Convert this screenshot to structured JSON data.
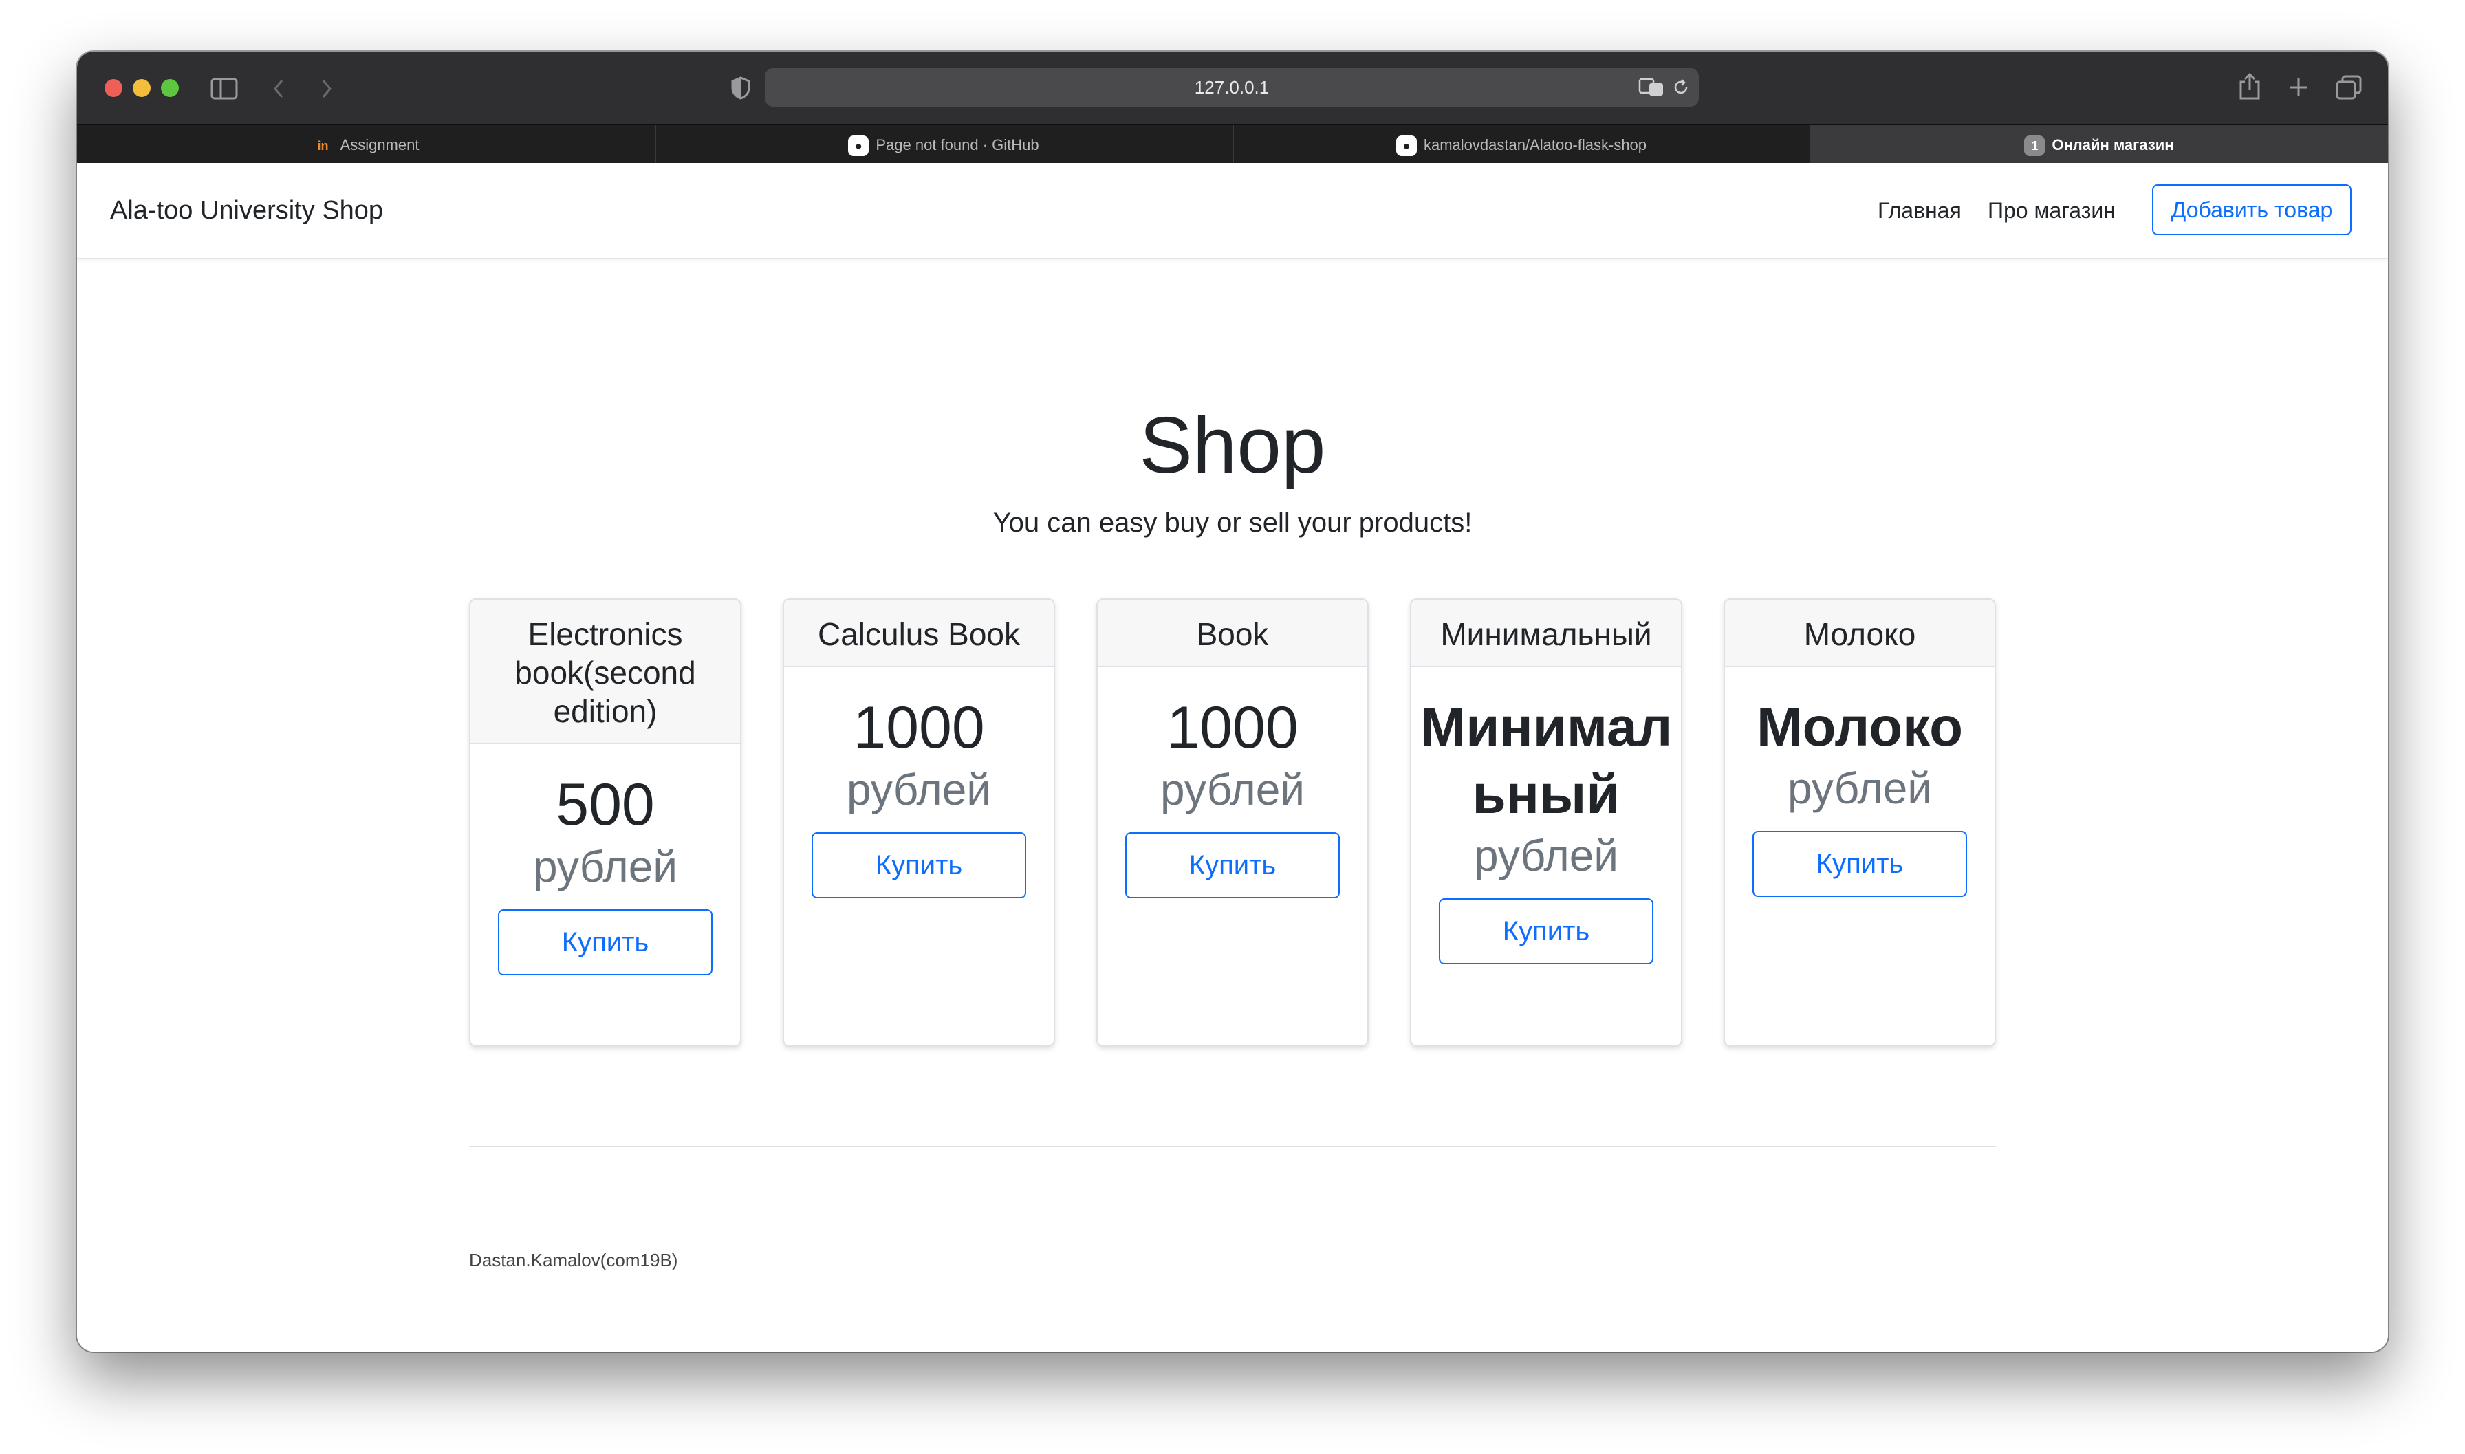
{
  "browser": {
    "url": "127.0.0.1",
    "tabs": [
      {
        "label": "Assignment",
        "icon": "invision-icon",
        "active": false
      },
      {
        "label": "Page not found · GitHub",
        "icon": "github-icon",
        "active": false
      },
      {
        "label": "kamalovdastan/Alatoo-flask-shop",
        "icon": "github-icon",
        "active": false
      },
      {
        "label": "Онлайн магазин",
        "icon": "tab-number-icon",
        "badge": "1",
        "active": true
      }
    ]
  },
  "navbar": {
    "brand": "Ala-too University Shop",
    "links": [
      "Главная",
      "Про магазин"
    ],
    "add_button": "Добавить товар"
  },
  "hero": {
    "title": "Shop",
    "subtitle": "You can easy buy or sell your products!"
  },
  "products": [
    {
      "name": "Electronics book(second edition)",
      "price": "500",
      "currency": "рублей",
      "button": "Купить"
    },
    {
      "name": "Calculus Book",
      "price": "1000",
      "currency": "рублей",
      "button": "Купить"
    },
    {
      "name": "Book",
      "price": "1000",
      "currency": "рублей",
      "button": "Купить"
    },
    {
      "name": "Минимальный",
      "price": "Минимальный",
      "currency": "рублей",
      "button": "Купить"
    },
    {
      "name": "Молоко",
      "price": "Молоко",
      "currency": "рублей",
      "button": "Купить"
    }
  ],
  "footer": {
    "text": "Dastan.Kamalov(com19B)"
  },
  "colors": {
    "accent": "#0d6efd",
    "muted": "#6c757d",
    "titlebar": "#2f2f31"
  }
}
